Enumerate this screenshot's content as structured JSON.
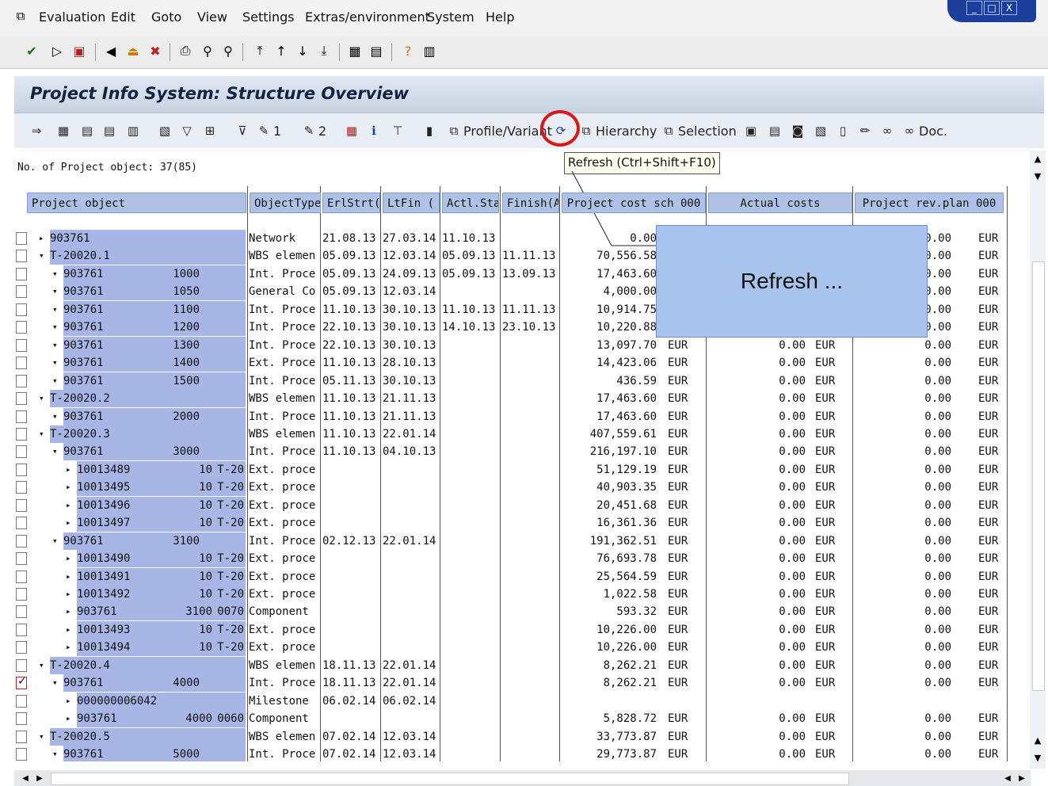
{
  "menu": [
    "Evaluation",
    "Edit",
    "Goto",
    "View",
    "Settings",
    "Extras/environment",
    "System",
    "Help"
  ],
  "window_buttons": [
    "_",
    "□",
    "X"
  ],
  "screen_title": "Project Info System: Structure Overview",
  "app_toolbar": {
    "profile_label": "Profile/Variant",
    "hierarchy_label": "Hierarchy",
    "selection_label": "Selection",
    "doc_label": "Doc.",
    "edit1_label": "1",
    "edit2_label": "2"
  },
  "tooltip": "Refresh   (Ctrl+Shift+F10)",
  "callout": "Refresh ...",
  "object_count": "No. of Project object: 37(85)",
  "columns": [
    "Project object",
    "ObjectType",
    "ErlStrt(",
    "LtFin  (",
    "Actl.Sta",
    "Finish(A",
    "Project cost sch 000",
    "Actual costs",
    "Project rev.plan 000"
  ],
  "rows": [
    {
      "id": "903761",
      "num": "",
      "code": "",
      "type": "Network",
      "erl": "21.08.13",
      "ltf": "27.03.14",
      "act": "11.10.13",
      "fin": "",
      "cost": "0.00",
      "cur1": "",
      "actual": "",
      "cur2": "",
      "rev": "0.00",
      "cur3": "EUR",
      "checked": false
    },
    {
      "id": "T-20020.1",
      "num": "",
      "code": "",
      "type": "WBS elemen",
      "erl": "05.09.13",
      "ltf": "12.03.14",
      "act": "05.09.13",
      "fin": "11.11.13",
      "cost": "70,556.58",
      "cur1": "",
      "actual": "",
      "cur2": "",
      "rev": "0.00",
      "cur3": "EUR",
      "checked": false
    },
    {
      "id": "903761",
      "num": "1000",
      "code": "",
      "type": "Int. Proce",
      "erl": "05.09.13",
      "ltf": "24.09.13",
      "act": "05.09.13",
      "fin": "13.09.13",
      "cost": "17,463.60",
      "cur1": "",
      "actual": "",
      "cur2": "",
      "rev": "0.00",
      "cur3": "EUR",
      "checked": false
    },
    {
      "id": "903761",
      "num": "1050",
      "code": "",
      "type": "General Co",
      "erl": "05.09.13",
      "ltf": "12.03.14",
      "act": "",
      "fin": "",
      "cost": "4,000.00",
      "cur1": "",
      "actual": "",
      "cur2": "",
      "rev": "0.00",
      "cur3": "EUR",
      "checked": false
    },
    {
      "id": "903761",
      "num": "1100",
      "code": "",
      "type": "Int. Proce",
      "erl": "11.10.13",
      "ltf": "30.10.13",
      "act": "11.10.13",
      "fin": "11.11.13",
      "cost": "10,914.75",
      "cur1": "",
      "actual": "",
      "cur2": "",
      "rev": "0.00",
      "cur3": "EUR",
      "checked": false
    },
    {
      "id": "903761",
      "num": "1200",
      "code": "",
      "type": "Int. Proce",
      "erl": "22.10.13",
      "ltf": "30.10.13",
      "act": "14.10.13",
      "fin": "23.10.13",
      "cost": "10,220.88",
      "cur1": "",
      "actual": "",
      "cur2": "",
      "rev": "0.00",
      "cur3": "EUR",
      "checked": false
    },
    {
      "id": "903761",
      "num": "1300",
      "code": "",
      "type": "Int. Proce",
      "erl": "22.10.13",
      "ltf": "30.10.13",
      "act": "",
      "fin": "",
      "cost": "13,097.70",
      "cur1": "EUR",
      "actual": "0.00",
      "cur2": "EUR",
      "rev": "0.00",
      "cur3": "EUR",
      "checked": false
    },
    {
      "id": "903761",
      "num": "1400",
      "code": "",
      "type": "Ext. Proce",
      "erl": "11.10.13",
      "ltf": "28.10.13",
      "act": "",
      "fin": "",
      "cost": "14,423.06",
      "cur1": "EUR",
      "actual": "0.00",
      "cur2": "EUR",
      "rev": "0.00",
      "cur3": "EUR",
      "checked": false
    },
    {
      "id": "903761",
      "num": "1500",
      "code": "",
      "type": "Int. Proce",
      "erl": "05.11.13",
      "ltf": "30.10.13",
      "act": "",
      "fin": "",
      "cost": "436.59",
      "cur1": "EUR",
      "actual": "0.00",
      "cur2": "EUR",
      "rev": "0.00",
      "cur3": "EUR",
      "checked": false
    },
    {
      "id": "T-20020.2",
      "num": "",
      "code": "",
      "type": "WBS elemen",
      "erl": "11.10.13",
      "ltf": "21.11.13",
      "act": "",
      "fin": "",
      "cost": "17,463.60",
      "cur1": "EUR",
      "actual": "0.00",
      "cur2": "EUR",
      "rev": "0.00",
      "cur3": "EUR",
      "checked": false
    },
    {
      "id": "903761",
      "num": "2000",
      "code": "",
      "type": "Int. Proce",
      "erl": "11.10.13",
      "ltf": "21.11.13",
      "act": "",
      "fin": "",
      "cost": "17,463.60",
      "cur1": "EUR",
      "actual": "0.00",
      "cur2": "EUR",
      "rev": "0.00",
      "cur3": "EUR",
      "checked": false
    },
    {
      "id": "T-20020.3",
      "num": "",
      "code": "",
      "type": "WBS elemen",
      "erl": "11.10.13",
      "ltf": "22.01.14",
      "act": "",
      "fin": "",
      "cost": "407,559.61",
      "cur1": "EUR",
      "actual": "0.00",
      "cur2": "EUR",
      "rev": "0.00",
      "cur3": "EUR",
      "checked": false
    },
    {
      "id": "903761",
      "num": "3000",
      "code": "",
      "type": "Int. Proce",
      "erl": "11.10.13",
      "ltf": "04.10.13",
      "act": "",
      "fin": "",
      "cost": "216,197.10",
      "cur1": "EUR",
      "actual": "0.00",
      "cur2": "EUR",
      "rev": "0.00",
      "cur3": "EUR",
      "checked": false
    },
    {
      "id": "10013489",
      "num": "10",
      "code": "T-20",
      "type": "Ext. proce",
      "erl": "",
      "ltf": "",
      "act": "",
      "fin": "",
      "cost": "51,129.19",
      "cur1": "EUR",
      "actual": "0.00",
      "cur2": "EUR",
      "rev": "0.00",
      "cur3": "EUR",
      "checked": false
    },
    {
      "id": "10013495",
      "num": "10",
      "code": "T-20",
      "type": "Ext. proce",
      "erl": "",
      "ltf": "",
      "act": "",
      "fin": "",
      "cost": "40,903.35",
      "cur1": "EUR",
      "actual": "0.00",
      "cur2": "EUR",
      "rev": "0.00",
      "cur3": "EUR",
      "checked": false
    },
    {
      "id": "10013496",
      "num": "10",
      "code": "T-20",
      "type": "Ext. proce",
      "erl": "",
      "ltf": "",
      "act": "",
      "fin": "",
      "cost": "20,451.68",
      "cur1": "EUR",
      "actual": "0.00",
      "cur2": "EUR",
      "rev": "0.00",
      "cur3": "EUR",
      "checked": false
    },
    {
      "id": "10013497",
      "num": "10",
      "code": "T-20",
      "type": "Ext. proce",
      "erl": "",
      "ltf": "",
      "act": "",
      "fin": "",
      "cost": "16,361.36",
      "cur1": "EUR",
      "actual": "0.00",
      "cur2": "EUR",
      "rev": "0.00",
      "cur3": "EUR",
      "checked": false
    },
    {
      "id": "903761",
      "num": "3100",
      "code": "",
      "type": "Int. Proce",
      "erl": "02.12.13",
      "ltf": "22.01.14",
      "act": "",
      "fin": "",
      "cost": "191,362.51",
      "cur1": "EUR",
      "actual": "0.00",
      "cur2": "EUR",
      "rev": "0.00",
      "cur3": "EUR",
      "checked": false
    },
    {
      "id": "10013490",
      "num": "10",
      "code": "T-20",
      "type": "Ext. proce",
      "erl": "",
      "ltf": "",
      "act": "",
      "fin": "",
      "cost": "76,693.78",
      "cur1": "EUR",
      "actual": "0.00",
      "cur2": "EUR",
      "rev": "0.00",
      "cur3": "EUR",
      "checked": false
    },
    {
      "id": "10013491",
      "num": "10",
      "code": "T-20",
      "type": "Ext. proce",
      "erl": "",
      "ltf": "",
      "act": "",
      "fin": "",
      "cost": "25,564.59",
      "cur1": "EUR",
      "actual": "0.00",
      "cur2": "EUR",
      "rev": "0.00",
      "cur3": "EUR",
      "checked": false
    },
    {
      "id": "10013492",
      "num": "10",
      "code": "T-20",
      "type": "Ext. proce",
      "erl": "",
      "ltf": "",
      "act": "",
      "fin": "",
      "cost": "1,022.58",
      "cur1": "EUR",
      "actual": "0.00",
      "cur2": "EUR",
      "rev": "0.00",
      "cur3": "EUR",
      "checked": false
    },
    {
      "id": "903761",
      "num": "3100",
      "code": "0070",
      "type": "Component",
      "erl": "",
      "ltf": "",
      "act": "",
      "fin": "",
      "cost": "593.32",
      "cur1": "EUR",
      "actual": "0.00",
      "cur2": "EUR",
      "rev": "0.00",
      "cur3": "EUR",
      "checked": false
    },
    {
      "id": "10013493",
      "num": "10",
      "code": "T-20",
      "type": "Ext. proce",
      "erl": "",
      "ltf": "",
      "act": "",
      "fin": "",
      "cost": "10,226.00",
      "cur1": "EUR",
      "actual": "0.00",
      "cur2": "EUR",
      "rev": "0.00",
      "cur3": "EUR",
      "checked": false
    },
    {
      "id": "10013494",
      "num": "10",
      "code": "T-20",
      "type": "Ext. proce",
      "erl": "",
      "ltf": "",
      "act": "",
      "fin": "",
      "cost": "10,226.00",
      "cur1": "EUR",
      "actual": "0.00",
      "cur2": "EUR",
      "rev": "0.00",
      "cur3": "EUR",
      "checked": false
    },
    {
      "id": "T-20020.4",
      "num": "",
      "code": "",
      "type": "WBS elemen",
      "erl": "18.11.13",
      "ltf": "22.01.14",
      "act": "",
      "fin": "",
      "cost": "8,262.21",
      "cur1": "EUR",
      "actual": "0.00",
      "cur2": "EUR",
      "rev": "0.00",
      "cur3": "EUR",
      "checked": false
    },
    {
      "id": "903761",
      "num": "4000",
      "code": "",
      "type": "Int. Proce",
      "erl": "18.11.13",
      "ltf": "22.01.14",
      "act": "",
      "fin": "",
      "cost": "8,262.21",
      "cur1": "EUR",
      "actual": "0.00",
      "cur2": "EUR",
      "rev": "0.00",
      "cur3": "EUR",
      "checked": true
    },
    {
      "id": "000000006042",
      "num": "",
      "code": "",
      "type": "Milestone",
      "erl": "06.02.14",
      "ltf": "06.02.14",
      "act": "",
      "fin": "",
      "cost": "",
      "cur1": "",
      "actual": "",
      "cur2": "",
      "rev": "",
      "cur3": "",
      "checked": false
    },
    {
      "id": "903761",
      "num": "4000",
      "code": "0060",
      "type": "Component",
      "erl": "",
      "ltf": "",
      "act": "",
      "fin": "",
      "cost": "5,828.72",
      "cur1": "EUR",
      "actual": "0.00",
      "cur2": "EUR",
      "rev": "0.00",
      "cur3": "EUR",
      "checked": false
    },
    {
      "id": "T-20020.5",
      "num": "",
      "code": "",
      "type": "WBS elemen",
      "erl": "07.02.14",
      "ltf": "12.03.14",
      "act": "",
      "fin": "",
      "cost": "33,773.87",
      "cur1": "EUR",
      "actual": "0.00",
      "cur2": "EUR",
      "rev": "0.00",
      "cur3": "EUR",
      "checked": false
    },
    {
      "id": "903761",
      "num": "5000",
      "code": "",
      "type": "Int. Proce",
      "erl": "07.02.14",
      "ltf": "12.03.14",
      "act": "",
      "fin": "",
      "cost": "29,773.87",
      "cur1": "EUR",
      "actual": "0.00",
      "cur2": "EUR",
      "rev": "0.00",
      "cur3": "EUR",
      "checked": false
    }
  ]
}
